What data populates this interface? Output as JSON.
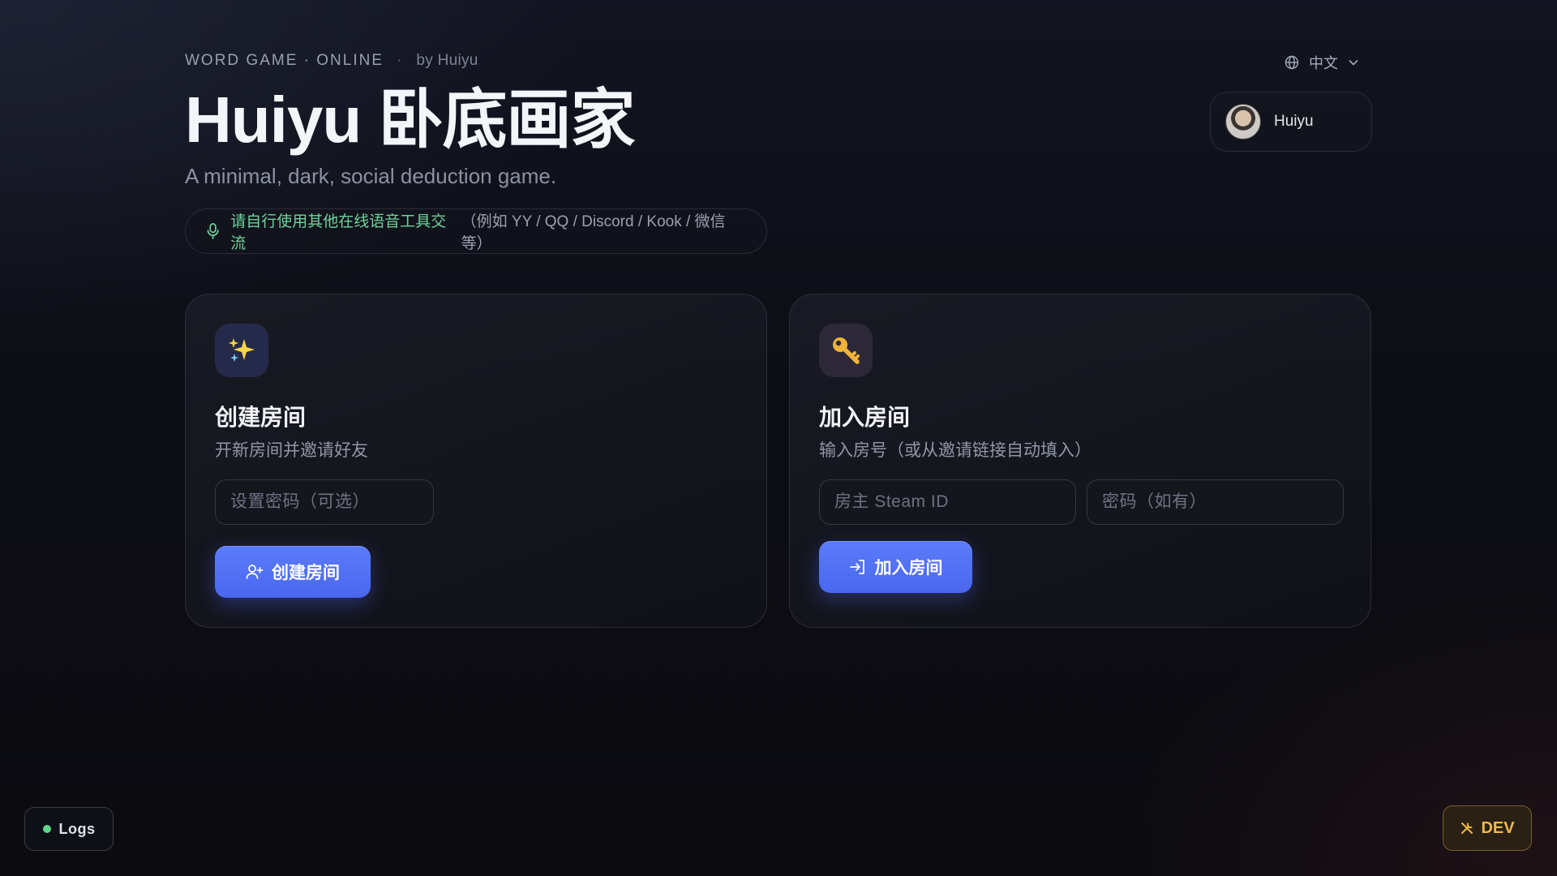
{
  "header": {
    "eyebrow": "WORD GAME · ONLINE",
    "eyebrow_sep": "·",
    "by": "by Huiyu",
    "title": "Huiyu 卧底画家",
    "subtitle": "A minimal, dark, social deduction game.",
    "notice_main": "请自行使用其他在线语音工具交流",
    "notice_examples": "（例如 YY / QQ / Discord / Kook / 微信 等）"
  },
  "language": {
    "current": "中文"
  },
  "user": {
    "name": "Huiyu"
  },
  "create_card": {
    "title": "创建房间",
    "desc": "开新房间并邀请好友",
    "password_placeholder": "设置密码（可选）",
    "button_label": "创建房间"
  },
  "join_card": {
    "title": "加入房间",
    "desc": "输入房号（或从邀请链接自动填入）",
    "steam_placeholder": "房主 Steam ID",
    "password_placeholder": "密码（如有）",
    "button_label": "加入房间"
  },
  "footer": {
    "logs_label": "Logs",
    "dev_label": "DEV"
  },
  "colors": {
    "accent": "#4f6ef3",
    "notice_green": "#6fd39a",
    "logs_led": "#5fd68a",
    "dev": "#f0b84a"
  },
  "icons": {
    "create": "sparkles-icon",
    "join": "key-icon",
    "notice": "microphone-icon",
    "language": "globe-icon",
    "dev": "tools-icon"
  }
}
